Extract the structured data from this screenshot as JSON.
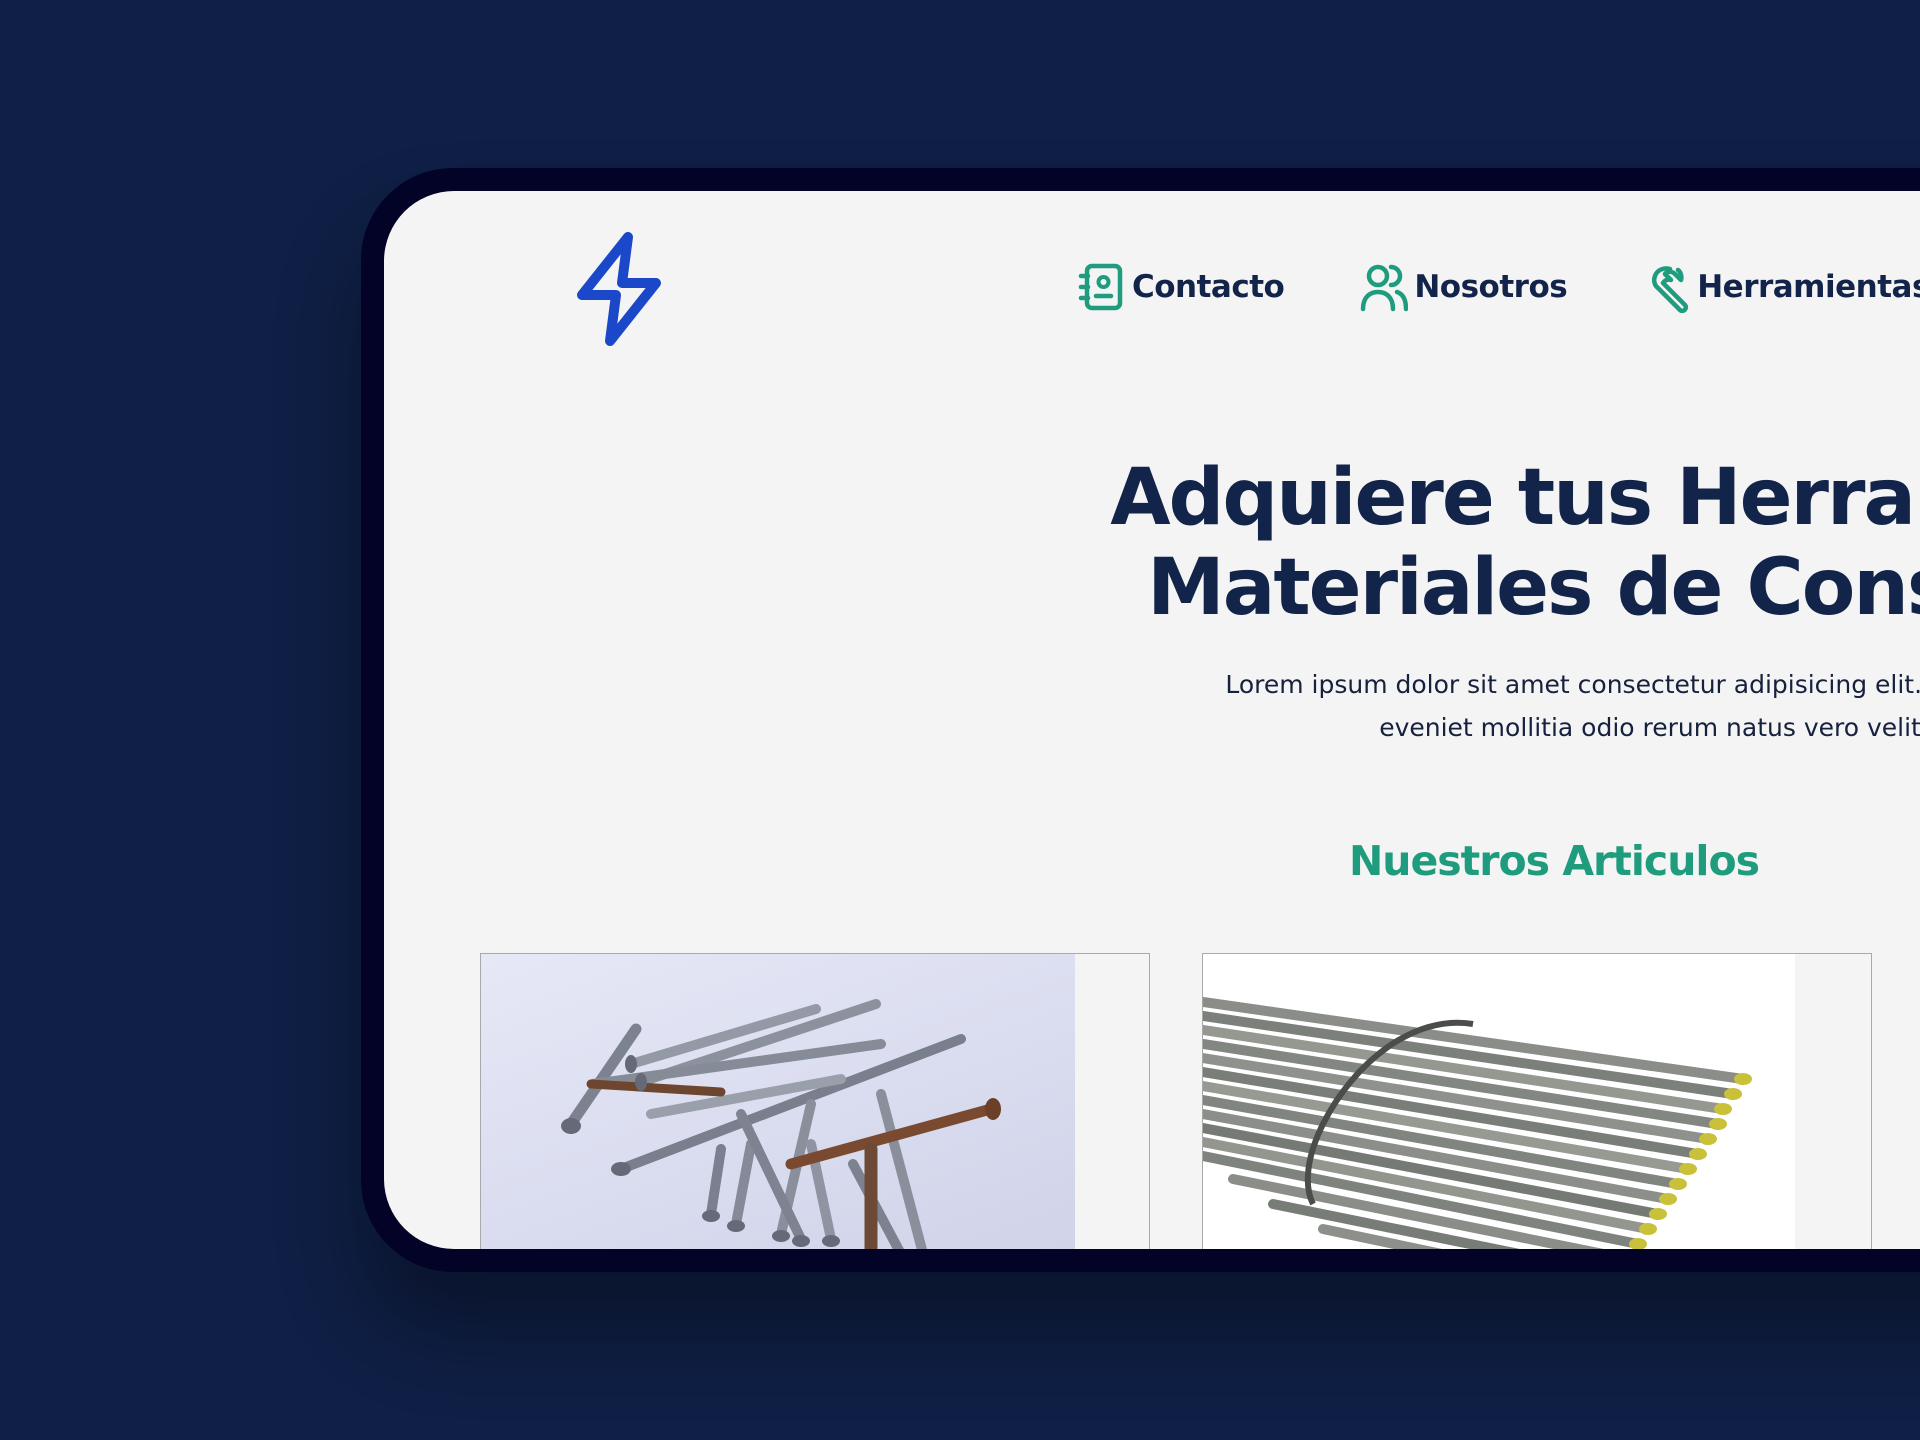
{
  "colors": {
    "backdrop": "#0f1f45",
    "device_frame": "#020326",
    "screen_bg": "#f4f4f4",
    "logo_blue": "#1a48c8",
    "nav_icon_green": "#1f9c7d",
    "title_navy": "#12244a",
    "section_green": "#1f9c7d"
  },
  "header": {
    "logo_icon": "lightning-bolt-icon",
    "nav": [
      {
        "label": "Contacto",
        "icon": "address-book-icon"
      },
      {
        "label": "Nosotros",
        "icon": "users-icon"
      },
      {
        "label": "Herramientas",
        "icon": "wrench-icon"
      }
    ]
  },
  "hero": {
    "title_line1": "Adquiere tus Herramient",
    "title_line2": "Materiales de Construc",
    "subtitle_line1": "Lorem ipsum dolor sit amet consectetur adipisicing elit. Eos veniam,",
    "subtitle_line2": "eveniet mollitia odio rerum natus vero velit."
  },
  "articles": {
    "title": "Nuestros Articulos",
    "cards": [
      {
        "image": "nails-photo"
      },
      {
        "image": "rebar-bundle-photo"
      }
    ]
  }
}
